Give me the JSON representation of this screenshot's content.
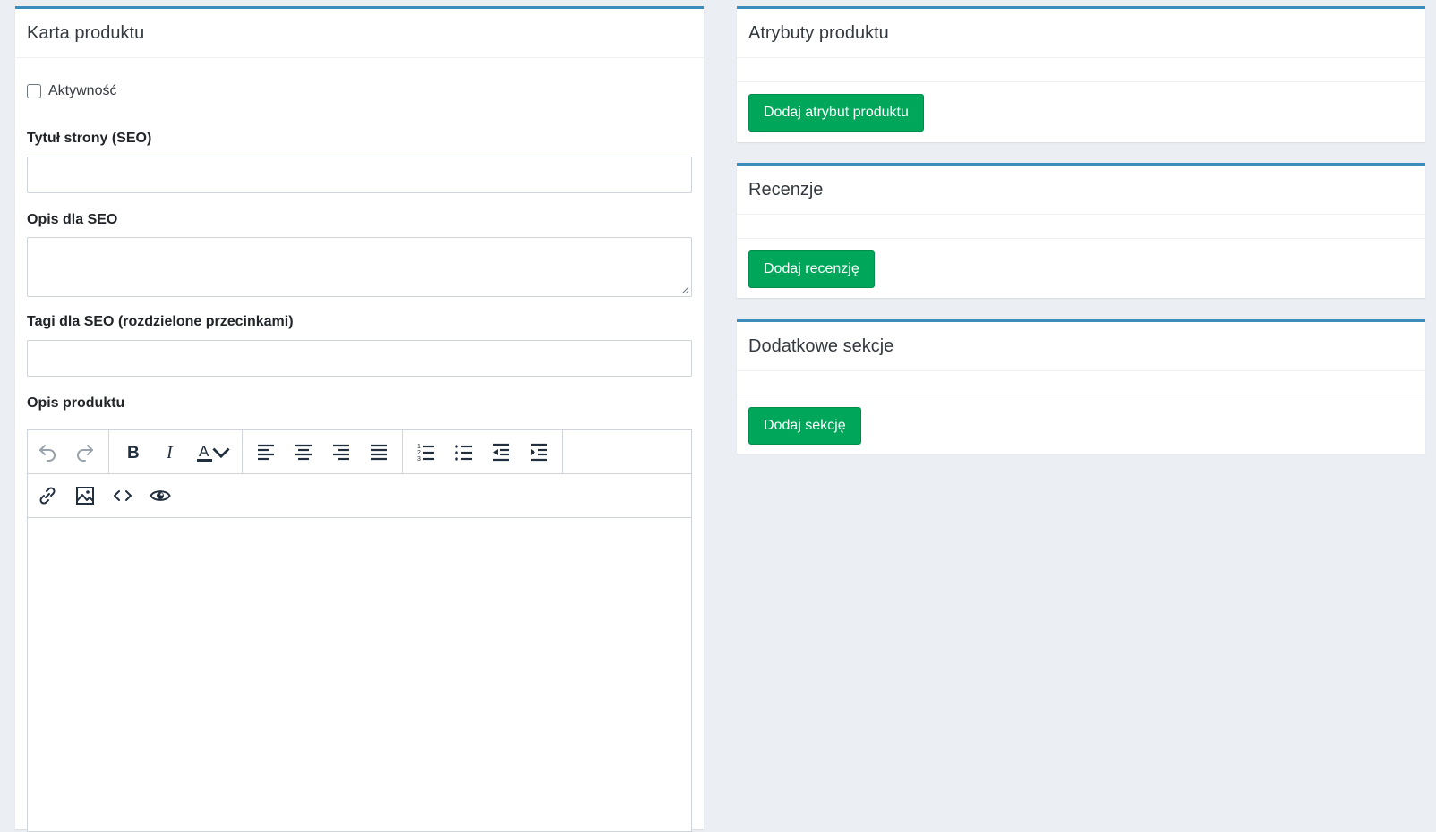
{
  "product_card": {
    "title": "Karta produktu",
    "active_label": "Aktywność",
    "seo_title_label": "Tytuł strony (SEO)",
    "seo_title_value": "",
    "seo_description_label": "Opis dla SEO",
    "seo_description_value": "",
    "seo_tags_label": "Tagi dla SEO (rozdzielone przecinkami)",
    "seo_tags_value": "",
    "description_label": "Opis produktu",
    "editor_toolbar": {
      "row1": [
        [
          "undo-icon",
          "redo-icon"
        ],
        [
          "bold-icon",
          "italic-icon",
          "text-color-icon"
        ],
        [
          "align-left-icon",
          "align-center-icon",
          "align-right-icon",
          "align-justify-icon"
        ],
        [
          "numbered-list-icon",
          "bullet-list-icon",
          "outdent-icon",
          "indent-icon"
        ]
      ],
      "row2": [
        "link-icon",
        "image-icon",
        "source-code-icon",
        "preview-icon"
      ]
    }
  },
  "attributes_card": {
    "title": "Atrybuty produktu",
    "add_button": "Dodaj atrybut produktu"
  },
  "reviews_card": {
    "title": "Recenzje",
    "add_button": "Dodaj recenzję"
  },
  "sections_card": {
    "title": "Dodatkowe sekcje",
    "add_button": "Dodaj sekcję"
  },
  "colors": {
    "accent": "#3c8dbc",
    "success": "#00a65a",
    "background": "#ebeef3"
  }
}
